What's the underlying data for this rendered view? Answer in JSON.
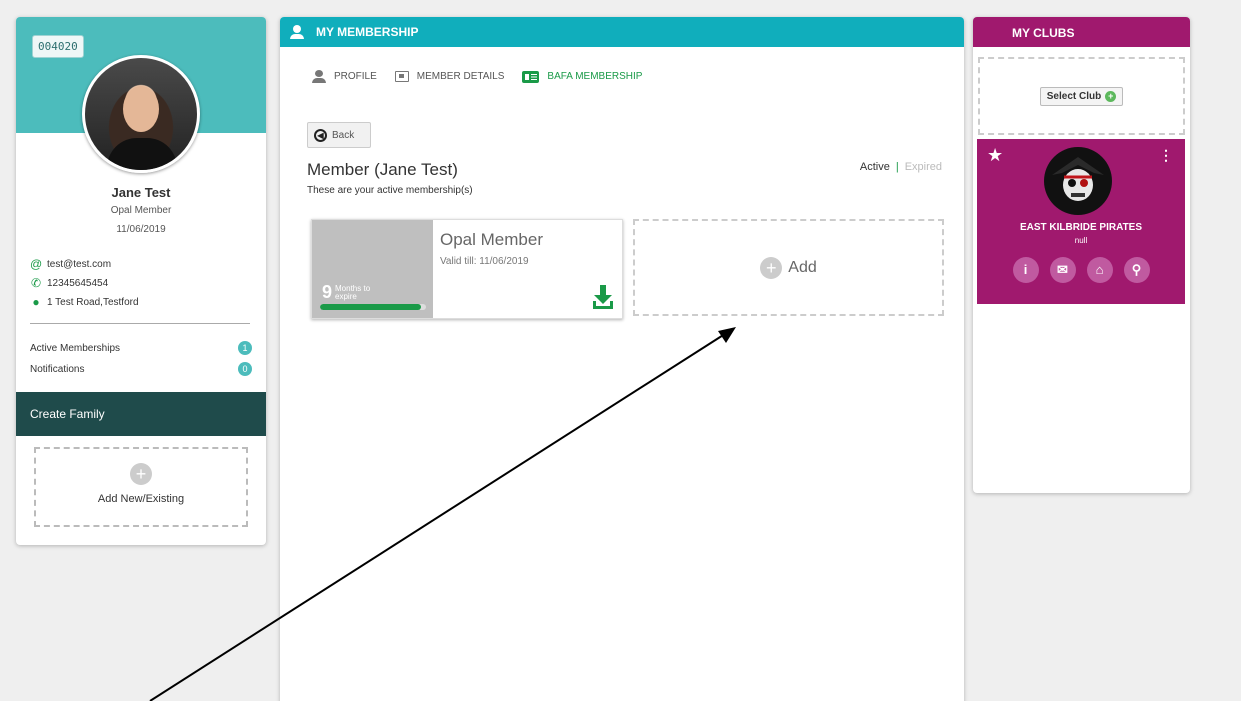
{
  "profile": {
    "member_id": "004020",
    "name": "Jane Test",
    "member_type": "Opal Member",
    "date": "11/06/2019",
    "email": "test@test.com",
    "phone": "12345645454",
    "address": "1 Test Road,Testford",
    "stats": [
      {
        "label": "Active Memberships",
        "count": "1"
      },
      {
        "label": "Notifications",
        "count": "0"
      }
    ],
    "create_family_label": "Create Family",
    "add_existing_label": "Add New/Existing"
  },
  "membership": {
    "header_title": "MY MEMBERSHIP",
    "tabs": [
      {
        "label": "PROFILE",
        "icon": "user-icon"
      },
      {
        "label": "MEMBER DETAILS",
        "icon": "id-card-icon"
      },
      {
        "label": "BAFA MEMBERSHIP",
        "icon": "bafa-card-icon",
        "active": true
      }
    ],
    "back_label": "Back",
    "title": "Member (Jane Test)",
    "subtitle": "These are your active membership(s)",
    "filter_active": "Active",
    "filter_sep": "|",
    "filter_expired": "Expired",
    "card": {
      "months": "9",
      "months_text_1": "Months to",
      "months_text_2": "expire",
      "progress_fraction": 0.95,
      "name": "Opal Member",
      "valid_till": "Valid till: 11/06/2019"
    },
    "add_label": "Add"
  },
  "clubs": {
    "header_title": "MY CLUBS",
    "select_club_label": "Select Club",
    "club": {
      "name": "EAST KILBRIDE PIRATES",
      "subtitle": "null"
    }
  },
  "colors": {
    "teal": "#4cbcbc",
    "header_teal": "#10aebc",
    "green": "#1a9a48",
    "club_purple": "#a0196e",
    "dark_teal": "#1f4b4b"
  }
}
